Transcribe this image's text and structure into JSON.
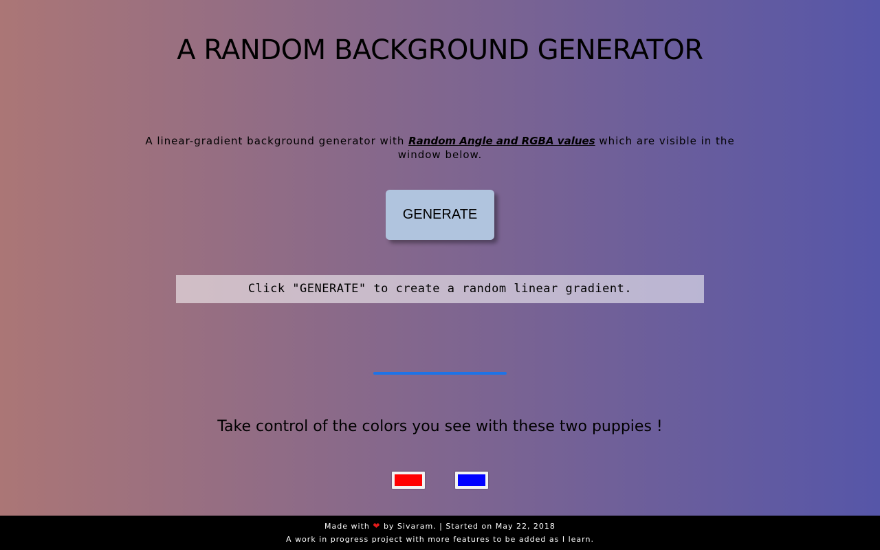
{
  "page": {
    "title": "A RANDOM BACKGROUND GENERATOR",
    "gradient": {
      "color_left": "#ab7676",
      "color_right": "#5656a8"
    }
  },
  "intro": {
    "text_before": "A linear-gradient background generator with ",
    "link_text": "Random Angle and RGBA values",
    "text_after": " which are visible in the window below."
  },
  "generate_button": {
    "label": "GENERATE"
  },
  "output": {
    "text": "Click \"GENERATE\" to create a random linear gradient."
  },
  "puppies": {
    "text": "Take control of the colors you see with these two puppies !",
    "color1": "#ff0000",
    "color2": "#0000ff"
  },
  "footer": {
    "made_with": "Made with",
    "heart_icon": "heart-icon",
    "by": "by Sivaram. | Started on May 22, 2018",
    "line2": "A work in progress project with more features to be added as I learn."
  }
}
